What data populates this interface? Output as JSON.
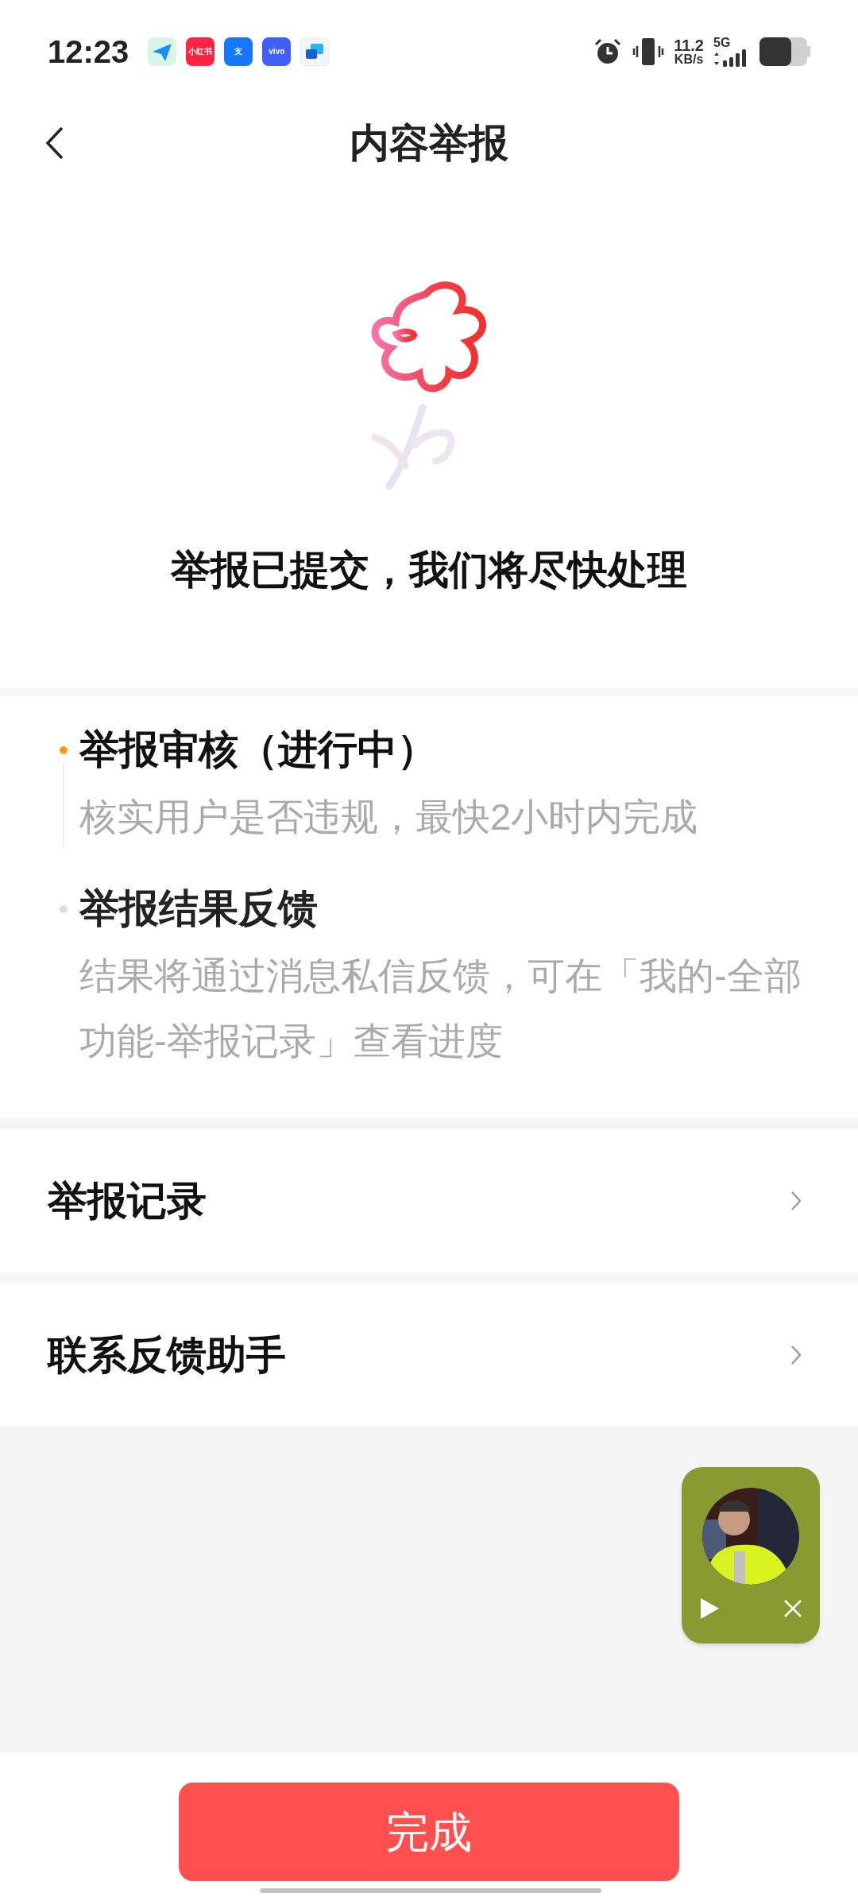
{
  "status_bar": {
    "time": "12:23",
    "app_icons": [
      {
        "kind": "plane"
      },
      {
        "kind": "label",
        "text": "小红书",
        "color": "#ff2442"
      },
      {
        "kind": "label",
        "text": "支",
        "color": "#1677ff"
      },
      {
        "kind": "label",
        "text": "vivo",
        "color": "#415fff"
      },
      {
        "kind": "chat"
      }
    ],
    "net_speed": "11.2",
    "net_unit": "KB/s",
    "network": "5G"
  },
  "header": {
    "title": "内容举报"
  },
  "result": {
    "message": "举报已提交，我们将尽快处理"
  },
  "steps": [
    {
      "title": "举报审核（进行中）",
      "description": "核实用户是否违规，最快2小时内完成",
      "active": true
    },
    {
      "title": "举报结果反馈",
      "description": "结果将通过消息私信反馈，可在「我的-全部功能-举报记录」查看进度",
      "active": false
    }
  ],
  "links": [
    {
      "label": "举报记录"
    },
    {
      "label": "联系反馈助手"
    }
  ],
  "done_button": {
    "label": "完成"
  }
}
